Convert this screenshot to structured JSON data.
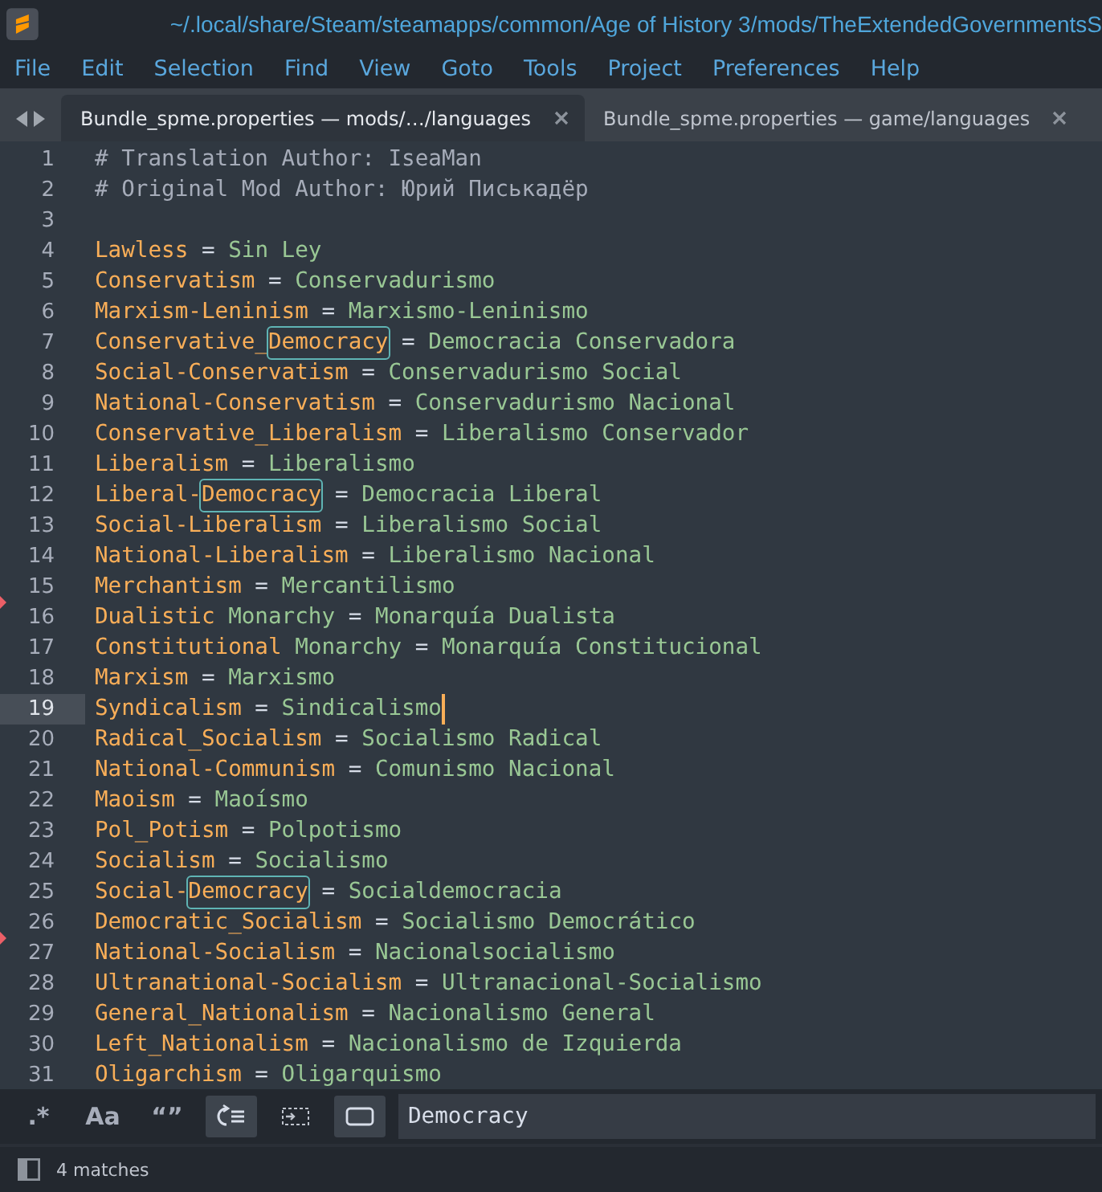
{
  "window": {
    "title": "~/.local/share/Steam/steamapps/common/Age of History 3/mods/TheExtendedGovernmentsS"
  },
  "menu": [
    "File",
    "Edit",
    "Selection",
    "Find",
    "View",
    "Goto",
    "Tools",
    "Project",
    "Preferences",
    "Help"
  ],
  "tabs": [
    {
      "label": "Bundle_spme.properties — mods/…/languages",
      "selected": true
    },
    {
      "label": "Bundle_spme.properties — game/languages",
      "selected": false
    }
  ],
  "editor": {
    "lines": [
      {
        "number": "1",
        "current": false,
        "marker": false,
        "tokens": [
          {
            "kind": "comment",
            "text": "# Translation Author: IseaMan"
          }
        ]
      },
      {
        "number": "2",
        "current": false,
        "marker": false,
        "tokens": [
          {
            "kind": "comment",
            "text": "# Original Mod Author: Юрий Писькадёр"
          }
        ]
      },
      {
        "number": "3",
        "current": false,
        "marker": false
      },
      {
        "number": "4",
        "current": false,
        "marker": false,
        "tokens": [
          {
            "kind": "key",
            "text": "Lawless"
          },
          {
            "kind": "op",
            "text": " = "
          },
          {
            "kind": "value",
            "text": "Sin Ley"
          }
        ]
      },
      {
        "number": "5",
        "current": false,
        "marker": false,
        "tokens": [
          {
            "kind": "key",
            "text": "Conservatism"
          },
          {
            "kind": "op",
            "text": " = "
          },
          {
            "kind": "value",
            "text": "Conservadurismo"
          }
        ]
      },
      {
        "number": "6",
        "current": false,
        "marker": false,
        "tokens": [
          {
            "kind": "key",
            "text": "Marxism-Leninism"
          },
          {
            "kind": "op",
            "text": " = "
          },
          {
            "kind": "value",
            "text": "Marxismo-Leninismo"
          }
        ]
      },
      {
        "number": "7",
        "current": false,
        "marker": false,
        "tokens": [
          {
            "kind": "key",
            "text": "Conservative_"
          },
          {
            "kind": "match",
            "text": "Democracy"
          },
          {
            "kind": "op",
            "text": " = "
          },
          {
            "kind": "value",
            "text": "Democracia Conservadora"
          }
        ]
      },
      {
        "number": "8",
        "current": false,
        "marker": false,
        "tokens": [
          {
            "kind": "key",
            "text": "Social-Conservatism"
          },
          {
            "kind": "op",
            "text": " = "
          },
          {
            "kind": "value",
            "text": "Conservadurismo Social"
          }
        ]
      },
      {
        "number": "9",
        "current": false,
        "marker": false,
        "tokens": [
          {
            "kind": "key",
            "text": "National-Conservatism"
          },
          {
            "kind": "op",
            "text": " = "
          },
          {
            "kind": "value",
            "text": "Conservadurismo Nacional"
          }
        ]
      },
      {
        "number": "10",
        "current": false,
        "marker": false,
        "tokens": [
          {
            "kind": "key",
            "text": "Conservative_Liberalism"
          },
          {
            "kind": "op",
            "text": " = "
          },
          {
            "kind": "value",
            "text": "Liberalismo Conservador"
          }
        ]
      },
      {
        "number": "11",
        "current": false,
        "marker": false,
        "tokens": [
          {
            "kind": "key",
            "text": "Liberalism"
          },
          {
            "kind": "op",
            "text": " = "
          },
          {
            "kind": "value",
            "text": "Liberalismo"
          }
        ]
      },
      {
        "number": "12",
        "current": false,
        "marker": false,
        "tokens": [
          {
            "kind": "key",
            "text": "Liberal-"
          },
          {
            "kind": "match",
            "text": "Democracy"
          },
          {
            "kind": "op",
            "text": " = "
          },
          {
            "kind": "value",
            "text": "Democracia Liberal"
          }
        ]
      },
      {
        "number": "13",
        "current": false,
        "marker": false,
        "tokens": [
          {
            "kind": "key",
            "text": "Social-Liberalism"
          },
          {
            "kind": "op",
            "text": " = "
          },
          {
            "kind": "value",
            "text": "Liberalismo Social"
          }
        ]
      },
      {
        "number": "14",
        "current": false,
        "marker": false,
        "tokens": [
          {
            "kind": "key",
            "text": "National-Liberalism"
          },
          {
            "kind": "op",
            "text": " = "
          },
          {
            "kind": "value",
            "text": "Liberalismo Nacional"
          }
        ]
      },
      {
        "number": "15",
        "current": false,
        "marker": true,
        "tokens": [
          {
            "kind": "key",
            "text": "Merchantism"
          },
          {
            "kind": "op",
            "text": " = "
          },
          {
            "kind": "value",
            "text": "Mercantilismo"
          }
        ]
      },
      {
        "number": "16",
        "current": false,
        "marker": false,
        "tokens": [
          {
            "kind": "key",
            "text": "Dualistic"
          },
          {
            "kind": "value",
            "text": " Monarchy"
          },
          {
            "kind": "op",
            "text": " = "
          },
          {
            "kind": "value",
            "text": "Monarquía Dualista"
          }
        ]
      },
      {
        "number": "17",
        "current": false,
        "marker": false,
        "tokens": [
          {
            "kind": "key",
            "text": "Constitutional"
          },
          {
            "kind": "value",
            "text": " Monarchy"
          },
          {
            "kind": "op",
            "text": " = "
          },
          {
            "kind": "value",
            "text": "Monarquía Constitucional"
          }
        ]
      },
      {
        "number": "18",
        "current": false,
        "marker": false,
        "tokens": [
          {
            "kind": "key",
            "text": "Marxism"
          },
          {
            "kind": "op",
            "text": " = "
          },
          {
            "kind": "value",
            "text": "Marxismo"
          }
        ]
      },
      {
        "number": "19",
        "current": true,
        "marker": false,
        "tokens": [
          {
            "kind": "key",
            "text": "Syndicalism"
          },
          {
            "kind": "op",
            "text": " = "
          },
          {
            "kind": "value",
            "text": "Sindicalismo"
          }
        ]
      },
      {
        "number": "20",
        "current": false,
        "marker": false,
        "tokens": [
          {
            "kind": "key",
            "text": "Radical_Socialism"
          },
          {
            "kind": "op",
            "text": " = "
          },
          {
            "kind": "value",
            "text": "Socialismo Radical"
          }
        ]
      },
      {
        "number": "21",
        "current": false,
        "marker": false,
        "tokens": [
          {
            "kind": "key",
            "text": "National-Communism"
          },
          {
            "kind": "op",
            "text": " = "
          },
          {
            "kind": "value",
            "text": "Comunismo Nacional"
          }
        ]
      },
      {
        "number": "22",
        "current": false,
        "marker": false,
        "tokens": [
          {
            "kind": "key",
            "text": "Maoism"
          },
          {
            "kind": "op",
            "text": " = "
          },
          {
            "kind": "value",
            "text": "Maoísmo"
          }
        ]
      },
      {
        "number": "23",
        "current": false,
        "marker": false,
        "tokens": [
          {
            "kind": "key",
            "text": "Pol_Potism"
          },
          {
            "kind": "op",
            "text": " = "
          },
          {
            "kind": "value",
            "text": "Polpotismo"
          }
        ]
      },
      {
        "number": "24",
        "current": false,
        "marker": false,
        "tokens": [
          {
            "kind": "key",
            "text": "Socialism"
          },
          {
            "kind": "op",
            "text": " = "
          },
          {
            "kind": "value",
            "text": "Socialismo"
          }
        ]
      },
      {
        "number": "25",
        "current": false,
        "marker": false,
        "tokens": [
          {
            "kind": "key",
            "text": "Social-"
          },
          {
            "kind": "match",
            "text": "Democracy"
          },
          {
            "kind": "op",
            "text": " = "
          },
          {
            "kind": "value",
            "text": "Socialdemocracia"
          }
        ]
      },
      {
        "number": "26",
        "current": false,
        "marker": true,
        "tokens": [
          {
            "kind": "key",
            "text": "Democratic_Socialism"
          },
          {
            "kind": "op",
            "text": " = "
          },
          {
            "kind": "value",
            "text": "Socialismo Democrático"
          }
        ]
      },
      {
        "number": "27",
        "current": false,
        "marker": false,
        "tokens": [
          {
            "kind": "key",
            "text": "National-Socialism"
          },
          {
            "kind": "op",
            "text": " = "
          },
          {
            "kind": "value",
            "text": "Nacionalsocialismo"
          }
        ]
      },
      {
        "number": "28",
        "current": false,
        "marker": false,
        "tokens": [
          {
            "kind": "key",
            "text": "Ultranational-Socialism"
          },
          {
            "kind": "op",
            "text": " = "
          },
          {
            "kind": "value",
            "text": "Ultranacional-Socialismo"
          }
        ]
      },
      {
        "number": "29",
        "current": false,
        "marker": false,
        "tokens": [
          {
            "kind": "key",
            "text": "General_Nationalism"
          },
          {
            "kind": "op",
            "text": " = "
          },
          {
            "kind": "value",
            "text": "Nacionalismo General"
          }
        ]
      },
      {
        "number": "30",
        "current": false,
        "marker": false,
        "tokens": [
          {
            "kind": "key",
            "text": "Left_Nationalism"
          },
          {
            "kind": "op",
            "text": " = "
          },
          {
            "kind": "value",
            "text": "Nacionalismo de Izquierda"
          }
        ]
      },
      {
        "number": "31",
        "current": false,
        "marker": false,
        "tokens": [
          {
            "kind": "key",
            "text": "Oligarchism"
          },
          {
            "kind": "op",
            "text": " = "
          },
          {
            "kind": "value",
            "text": "Oligarquismo"
          }
        ]
      }
    ]
  },
  "find_panel": {
    "options": [
      {
        "kind": "text",
        "label": ".*",
        "selected": false
      },
      {
        "kind": "text",
        "label": "Aa",
        "selected": false
      },
      {
        "kind": "text",
        "label": "“”",
        "selected": false
      },
      {
        "kind": "wrap",
        "selected": true
      },
      {
        "kind": "in-selection",
        "selected": false
      },
      {
        "kind": "highlight",
        "selected": true
      }
    ],
    "query": "Democracy"
  },
  "status_bar": {
    "text": "4 matches"
  }
}
